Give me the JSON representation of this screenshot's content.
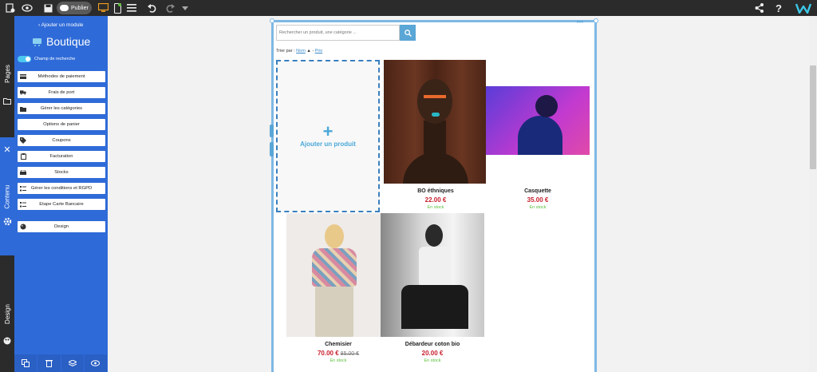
{
  "topbar": {
    "publish_label": "Publier"
  },
  "left_tabs": {
    "pages": "Pages",
    "contenu": "Contenu",
    "design": "Design"
  },
  "panel": {
    "add_module": "Ajouter un module",
    "title": "Boutique",
    "search_toggle_label": "Champ de recherche",
    "menu": [
      {
        "label": "Méthodes de paiement",
        "icon": "credit-card-icon"
      },
      {
        "label": "Frais de port",
        "icon": "truck-icon"
      },
      {
        "label": "Gérer les catégories",
        "icon": "folder-icon"
      },
      {
        "label": "Options de panier",
        "icon": ""
      },
      {
        "label": "Coupons",
        "icon": "tag-icon"
      },
      {
        "label": "Facturation",
        "icon": "clipboard-icon"
      },
      {
        "label": "Stocks",
        "icon": "box-icon"
      },
      {
        "label": "Gérer les conditions et RGPD",
        "icon": "list-icon"
      },
      {
        "label": "Etape Carte Bancaire",
        "icon": "list-icon"
      },
      {
        "label": "Design",
        "icon": "palette-icon"
      }
    ]
  },
  "shop": {
    "search_placeholder": "Rechercher un produit, une catégorie ...",
    "sort_prefix": "Trier par :",
    "sort_name": "Nom",
    "sort_name_arrow": "▲",
    "sort_price_prefix": "-",
    "sort_price": "Prix",
    "add_product_label": "Ajouter un produit",
    "products": [
      {
        "name": "BO éthniques",
        "price": "22.00 €",
        "old_price": "",
        "stock": "En stock"
      },
      {
        "name": "Casquette",
        "price": "35.00 €",
        "old_price": "",
        "stock": "En stock"
      },
      {
        "name": "Chemisier",
        "price": "70.00 €",
        "old_price": "85.00 €",
        "stock": "En stock"
      },
      {
        "name": "Débardeur coton bio",
        "price": "20.00 €",
        "old_price": "",
        "stock": "En stock"
      }
    ]
  },
  "colors": {
    "panel_blue": "#2f6bd8",
    "price_red": "#c8202e",
    "stock_green": "#5bbf3a",
    "frame_blue": "#7fb8e4"
  }
}
